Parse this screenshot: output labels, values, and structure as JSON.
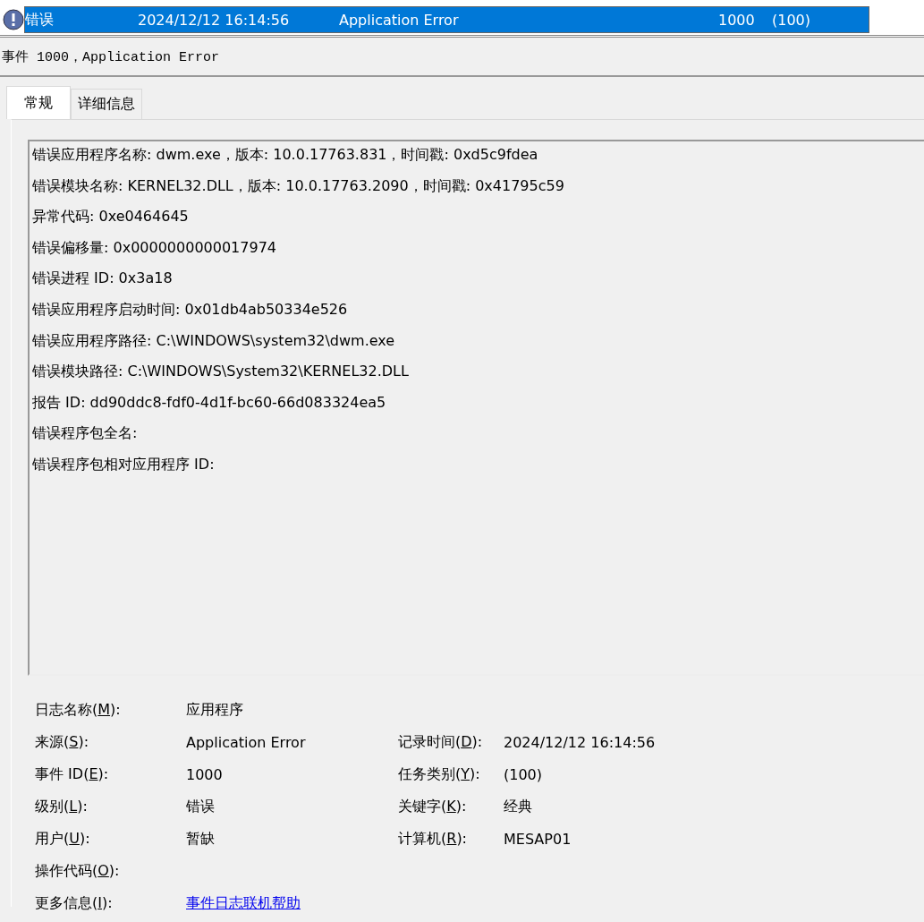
{
  "event_list": {
    "rows": [
      {
        "level": "错误",
        "date": "2024/12/12 16:14:56",
        "source": "Application Error",
        "event_id": "1000",
        "task_category": "(100)",
        "selected": true
      }
    ]
  },
  "event_header": "事件 1000，Application Error",
  "tabs": [
    {
      "label": "常规",
      "selected": true
    },
    {
      "label": "详细信息",
      "selected": false
    }
  ],
  "description": [
    "错误应用程序名称: dwm.exe，版本: 10.0.17763.831，时间戳: 0xd5c9fdea",
    "错误模块名称: KERNEL32.DLL，版本: 10.0.17763.2090，时间戳: 0x41795c59",
    "异常代码: 0xe0464645",
    "错误偏移量: 0x0000000000017974",
    "错误进程 ID: 0x3a18",
    "错误应用程序启动时间: 0x01db4ab50334e526",
    "错误应用程序路径: C:\\WINDOWS\\system32\\dwm.exe",
    "错误模块路径: C:\\WINDOWS\\System32\\KERNEL32.DLL",
    "报告 ID: dd90ddc8-fdf0-4d1f-bc60-66d083324ea5",
    "错误程序包全名:",
    "错误程序包相对应用程序 ID:"
  ],
  "details": [
    [
      {
        "before": "日志名称(",
        "key": "M",
        "after": "):",
        "value": "应用程序"
      }
    ],
    [
      {
        "before": "来源(",
        "key": "S",
        "after": "):",
        "value": "Application Error"
      },
      {
        "before": "记录时间(",
        "key": "D",
        "after": "):",
        "value": "2024/12/12 16:14:56"
      }
    ],
    [
      {
        "before": "事件 ID(",
        "key": "E",
        "after": "):",
        "value": "1000"
      },
      {
        "before": "任务类别(",
        "key": "Y",
        "after": "):",
        "value": "(100)"
      }
    ],
    [
      {
        "before": "级别(",
        "key": "L",
        "after": "):",
        "value": "错误"
      },
      {
        "before": "关键字(",
        "key": "K",
        "after": "):",
        "value": "经典"
      }
    ],
    [
      {
        "before": "用户(",
        "key": "U",
        "after": "):",
        "value": "暂缺"
      },
      {
        "before": "计算机(",
        "key": "R",
        "after": "):",
        "value": "MESAP01"
      }
    ],
    [
      {
        "before": "操作代码(",
        "key": "O",
        "after": "):"
      }
    ],
    [
      {
        "before": "更多信息(",
        "key": "I",
        "after": "):",
        "link": "事件日志联机帮助"
      }
    ]
  ]
}
